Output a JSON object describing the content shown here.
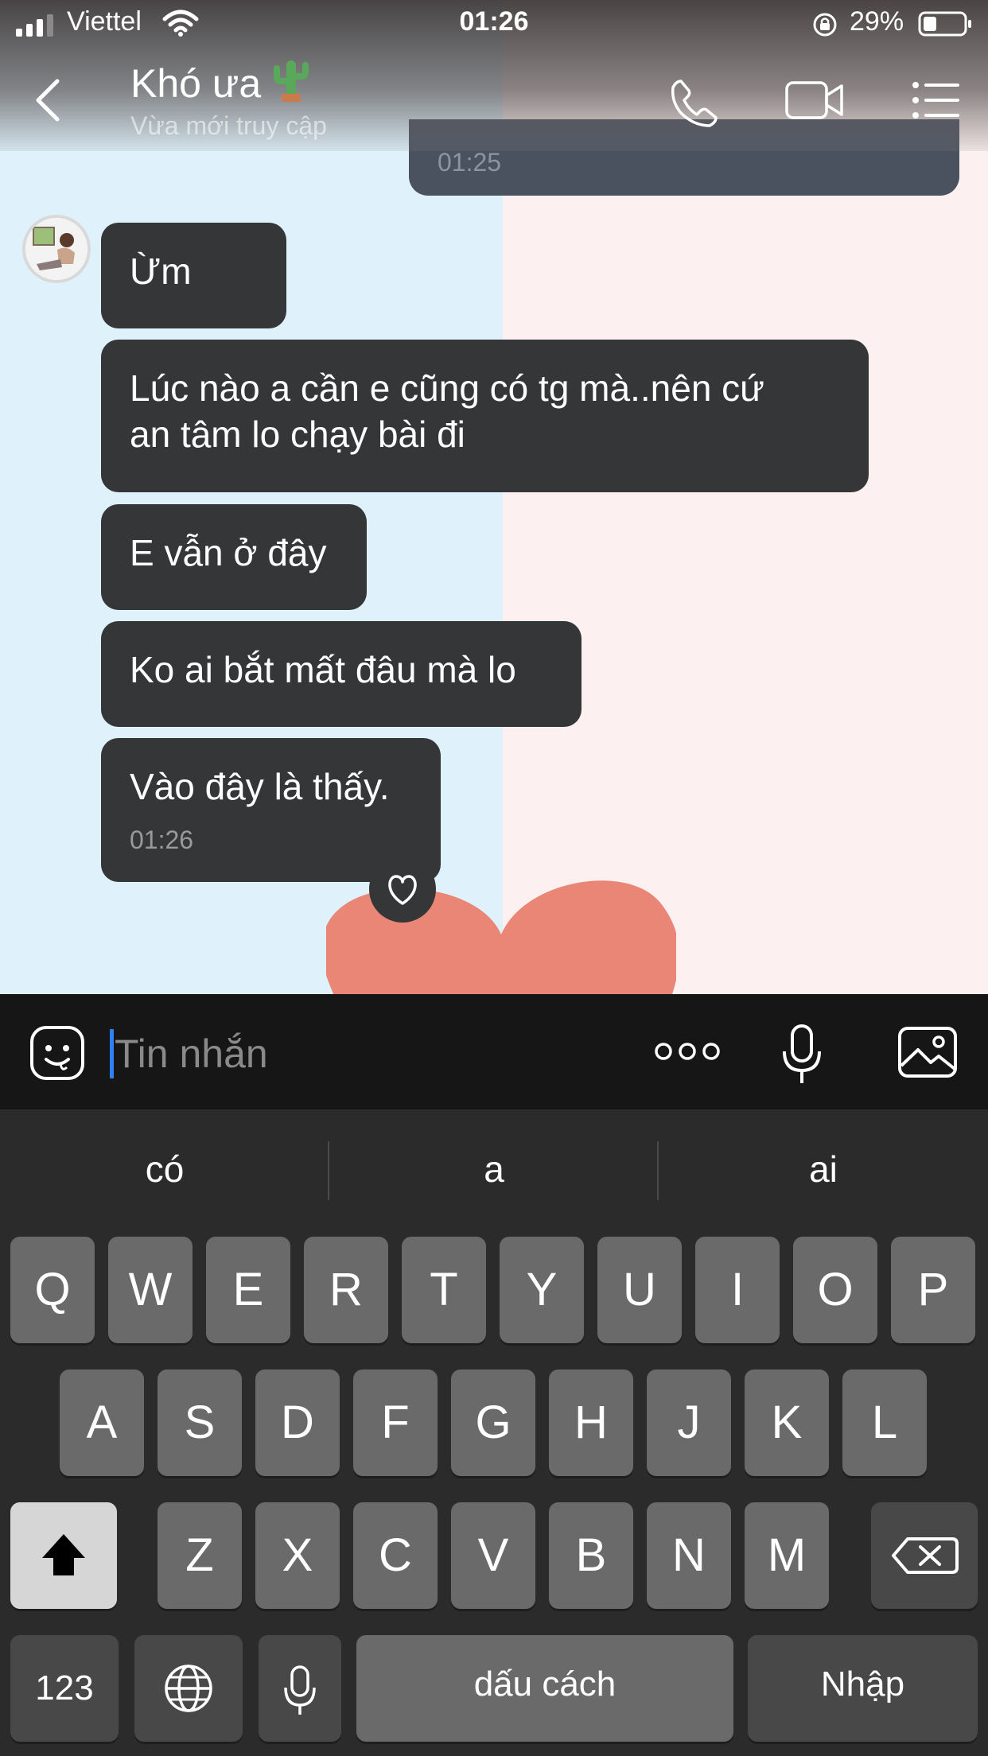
{
  "status_bar": {
    "carrier": "Viettel",
    "time": "01:26",
    "battery_percent": "29%"
  },
  "header": {
    "title": "Khó ưa",
    "title_emoji_icon": "cactus-icon",
    "subtitle": "Vừa mới truy cập",
    "actions": [
      "phone-icon",
      "video-camera-icon",
      "menu-list-icon"
    ]
  },
  "chat": {
    "sent_partial_timestamp": "01:25",
    "messages": [
      {
        "text": "Ừm"
      },
      {
        "line1": "Lúc nào a cần e cũng có tg mà..nên cứ",
        "line2": "an tâm lo chạy bài đi"
      },
      {
        "text": "E vẫn ở đây"
      },
      {
        "text": "Ko ai bắt mất đâu mà lo"
      },
      {
        "text": "Vào đây là thấy.",
        "time": "01:26"
      }
    ],
    "reaction_icon": "heart-outline-icon"
  },
  "input": {
    "placeholder": "Tin nhắn"
  },
  "keyboard": {
    "suggestions": [
      "có",
      "a",
      "ai"
    ],
    "row1": [
      "Q",
      "W",
      "E",
      "R",
      "T",
      "Y",
      "U",
      "I",
      "O",
      "P"
    ],
    "row2": [
      "A",
      "S",
      "D",
      "F",
      "G",
      "H",
      "J",
      "K",
      "L"
    ],
    "row3": [
      "Z",
      "X",
      "C",
      "V",
      "B",
      "N",
      "M"
    ],
    "numbers_key": "123",
    "space_key": "dấu cách",
    "return_key": "Nhập"
  },
  "colors": {
    "bubble": "#353637",
    "bg_left": "#dff2fc",
    "bg_right": "#fdf0f0",
    "heart": "#e98676",
    "caret": "#2f7ff5"
  }
}
